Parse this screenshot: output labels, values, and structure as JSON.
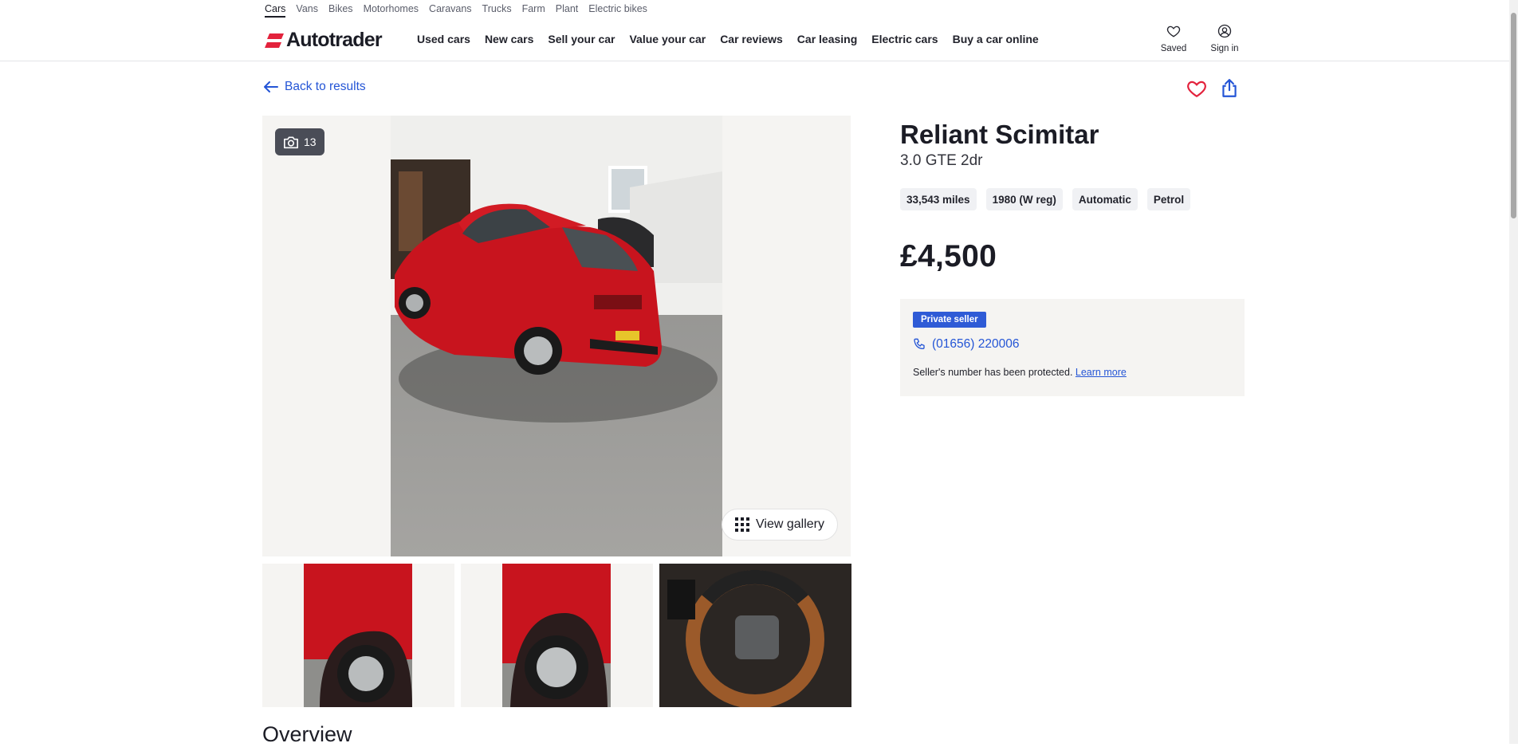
{
  "vehicle_types": [
    "Cars",
    "Vans",
    "Bikes",
    "Motorhomes",
    "Caravans",
    "Trucks",
    "Farm",
    "Plant",
    "Electric bikes"
  ],
  "header": {
    "logo_text": "Autotrader",
    "nav": [
      "Used cars",
      "New cars",
      "Sell your car",
      "Value your car",
      "Car reviews",
      "Car leasing",
      "Electric cars",
      "Buy a car online"
    ],
    "saved_label": "Saved",
    "signin_label": "Sign in"
  },
  "back_label": "Back to results",
  "gallery": {
    "photo_count": "13",
    "view_gallery_label": "View gallery"
  },
  "listing": {
    "title": "Reliant Scimitar",
    "subtitle": "3.0 GTE 2dr",
    "specs": [
      "33,543 miles",
      "1980 (W reg)",
      "Automatic",
      "Petrol"
    ],
    "price": "£4,500"
  },
  "seller": {
    "badge": "Private seller",
    "phone": "(01656) 220006",
    "protected_text": "Seller's number has been protected.",
    "learn_more": "Learn more"
  },
  "section_heading": "Overview",
  "colors": {
    "brand_red": "#e3223c",
    "link_blue": "#2455d6",
    "badge_blue": "#2f5bd6",
    "car_red": "#c8141e"
  }
}
